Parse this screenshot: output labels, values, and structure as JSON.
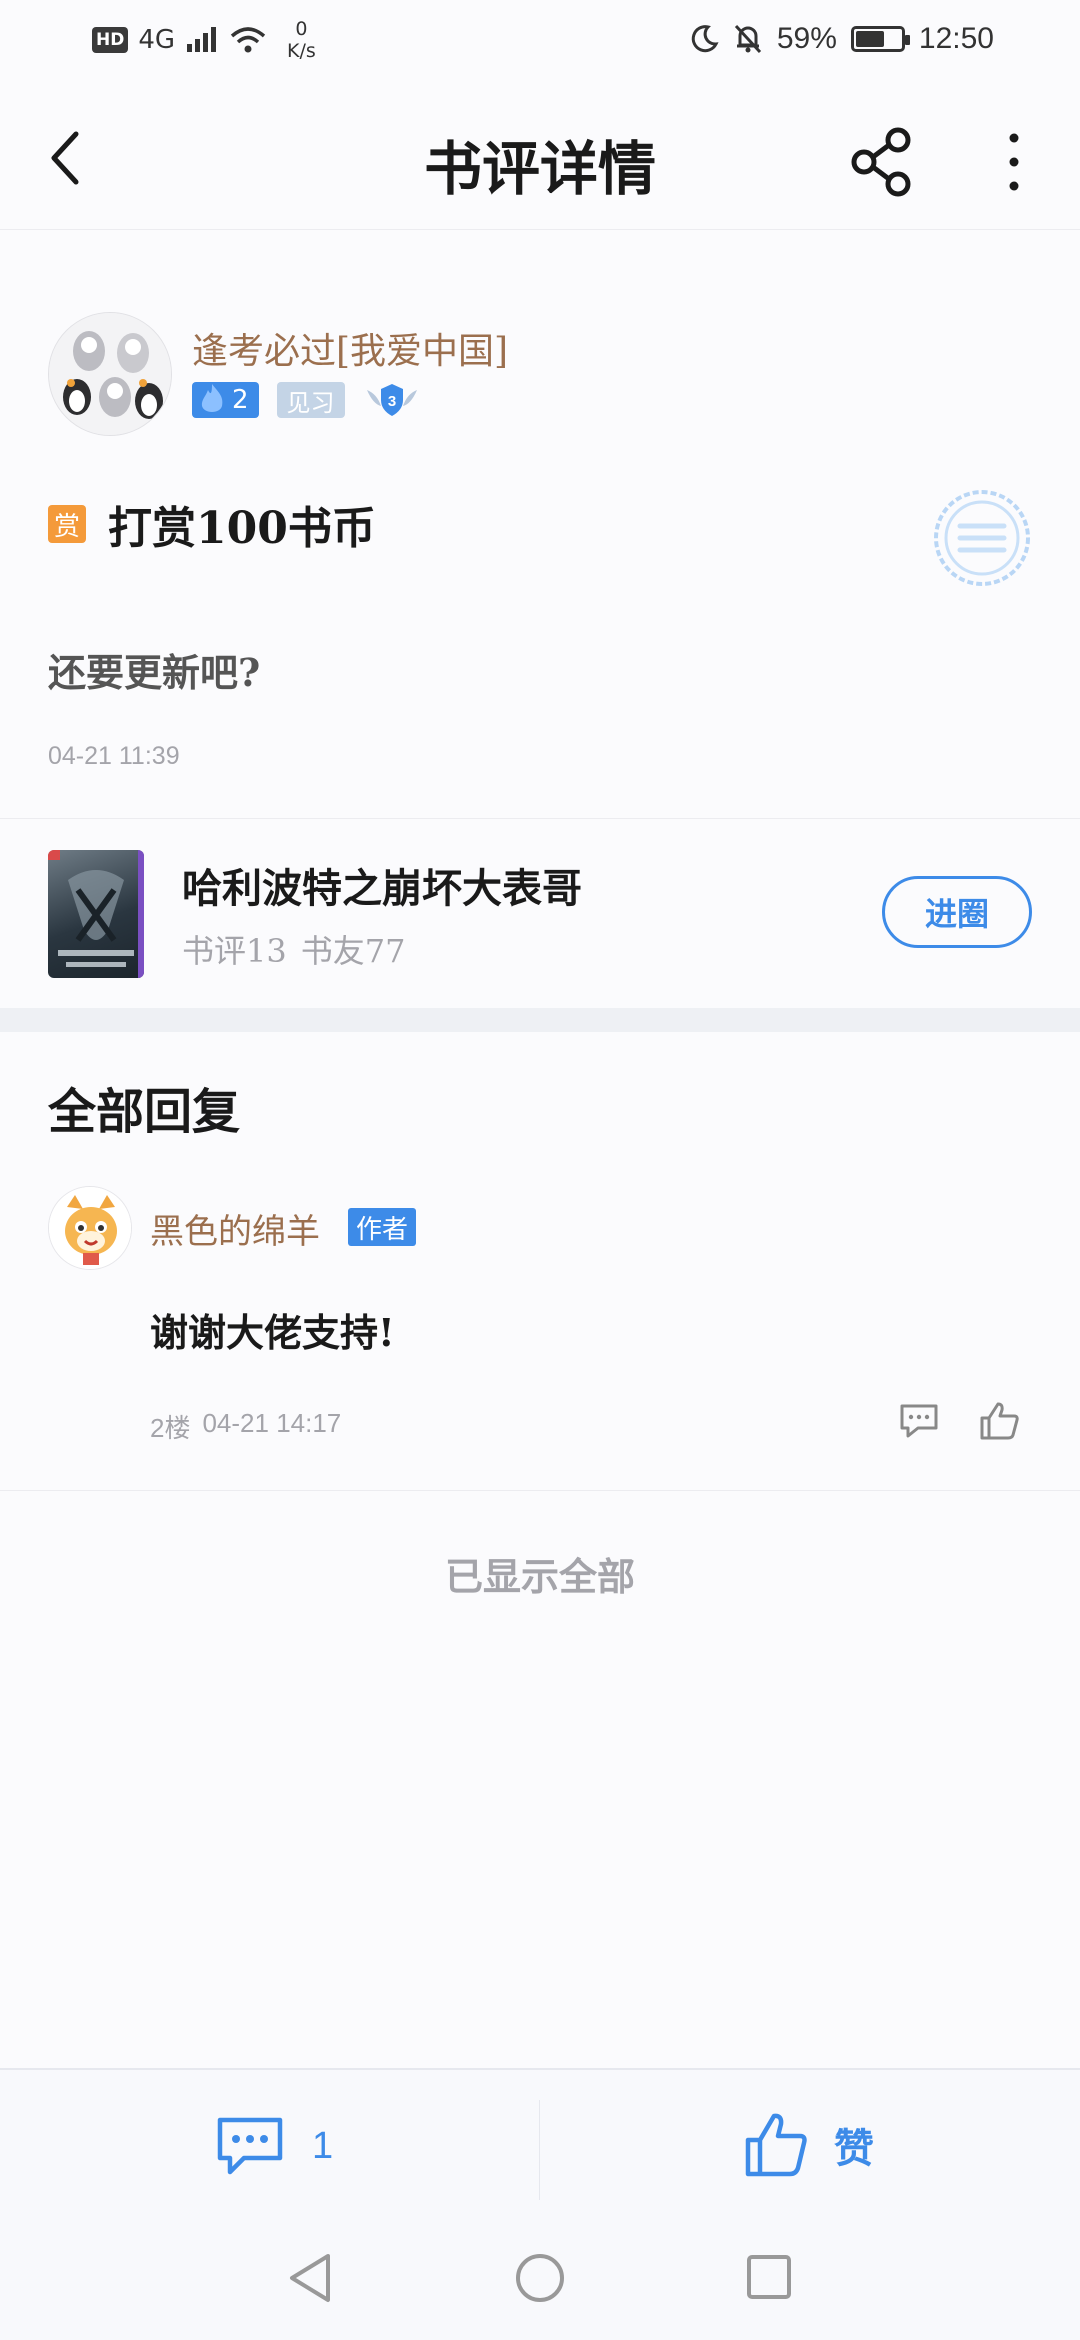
{
  "status_bar": {
    "hd": "HD",
    "network": "4G",
    "speed_value": "0",
    "speed_unit": "K/s",
    "battery": "59%",
    "time": "12:50"
  },
  "header": {
    "title": "书评详情"
  },
  "post": {
    "author": "逢考必过[我爱中国]",
    "level": "2",
    "title_badge": "见习",
    "rank": "3",
    "reward_icon": "赏",
    "reward_text": "打赏100书币",
    "body": "还要更新吧?",
    "time": "04-21 11:39"
  },
  "book": {
    "title": "哈利波特之崩坏大表哥",
    "review_stat": "书评13",
    "friend_stat": "书友77",
    "join_label": "进圈"
  },
  "replies_section": {
    "title": "全部回复",
    "items": [
      {
        "author": "黑色的绵羊",
        "tag": "作者",
        "body": "谢谢大佬支持!",
        "floor": "2楼",
        "time": "04-21 14:17"
      }
    ],
    "end_text": "已显示全部"
  },
  "action_bar": {
    "comment_count": "1",
    "like_label": "赞"
  },
  "colors": {
    "accent": "#3d8be8",
    "username": "#9b6f4e",
    "muted": "#a4a4aa",
    "reward": "#f49a3a"
  },
  "icons": {
    "back": "chevron-left-icon",
    "share": "share-icon",
    "more": "more-vertical-icon",
    "comment": "comment-icon",
    "like": "thumbs-up-icon"
  }
}
